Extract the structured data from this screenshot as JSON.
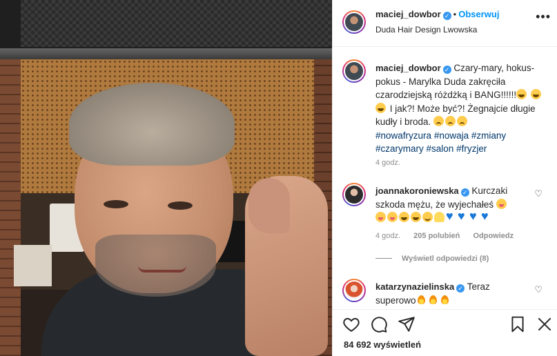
{
  "post": {
    "author": "maciej_dowbor",
    "follow_label": "Obserwuj",
    "location": "Duda Hair Design Lwowska",
    "more": "•••"
  },
  "caption": {
    "author": "maciej_dowbor",
    "text_1": "Czary-mary, hokus-pokus - Marylka Duda zakręciła czarodziejską różdżką i BANG!!!!!!",
    "text_2": "I jak?! Może być?! Żegnajcie długie kudły i broda.",
    "hashtags": [
      "#nowafryzura",
      "#nowaja",
      "#zmiany",
      "#czarymary",
      "#salon",
      "#fryzjer"
    ],
    "time": "4 godz."
  },
  "comments": [
    {
      "author": "joannakoroniewska",
      "text": "Kurczaki szkoda mężu, że wyjechałeś",
      "time": "4 godz.",
      "likes": "205 polubień",
      "reply": "Odpowiedz",
      "view_replies": "Wyświetl odpowiedzi (8)"
    },
    {
      "author": "katarzynazielinska",
      "text": "Teraz superowo"
    }
  ],
  "footer": {
    "views_count": "84 692",
    "views_label": "wyświetleń"
  },
  "icons": {
    "like": "heart-outline-icon",
    "comment": "comment-bubble-icon",
    "share": "paper-plane-icon",
    "save": "bookmark-icon"
  },
  "colors": {
    "accent": "#0095f6",
    "verified": "#3897f0",
    "hashtag": "#00376b",
    "muted": "#8e8e8e"
  }
}
